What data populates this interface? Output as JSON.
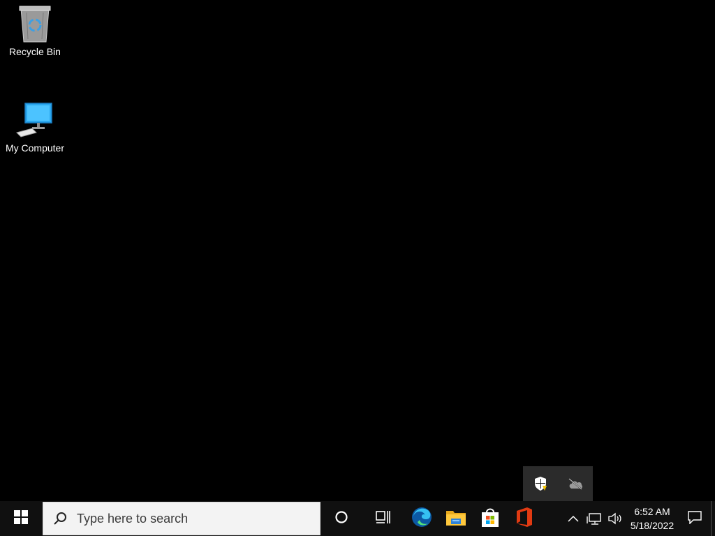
{
  "desktop": {
    "icons": [
      {
        "label": "Recycle Bin",
        "icon": "recycle-bin-icon"
      },
      {
        "label": "My Computer",
        "icon": "computer-icon"
      }
    ]
  },
  "tray_flyout": {
    "icons": [
      "windows-security-icon",
      "onedrive-offline-icon"
    ]
  },
  "taskbar": {
    "start_icon": "windows-logo-icon",
    "search": {
      "placeholder": "Type here to search",
      "icon": "search-icon"
    },
    "cortana_icon": "cortana-icon",
    "taskview_icon": "task-view-icon",
    "pinned_apps": [
      {
        "name": "Microsoft Edge",
        "icon": "edge-icon"
      },
      {
        "name": "File Explorer",
        "icon": "file-explorer-icon"
      },
      {
        "name": "Microsoft Store",
        "icon": "store-icon"
      },
      {
        "name": "Office",
        "icon": "office-icon"
      }
    ],
    "tray": {
      "icons": [
        "chevron-up-icon",
        "network-icon",
        "volume-icon"
      ],
      "time": "6:52 AM",
      "date": "5/18/2022",
      "notification_icon": "action-center-icon"
    }
  },
  "colors": {
    "desktop_bg": "#000000",
    "taskbar_bg": "#101010",
    "search_bg": "#f3f3f3",
    "accent_blue": "#0078d7"
  }
}
